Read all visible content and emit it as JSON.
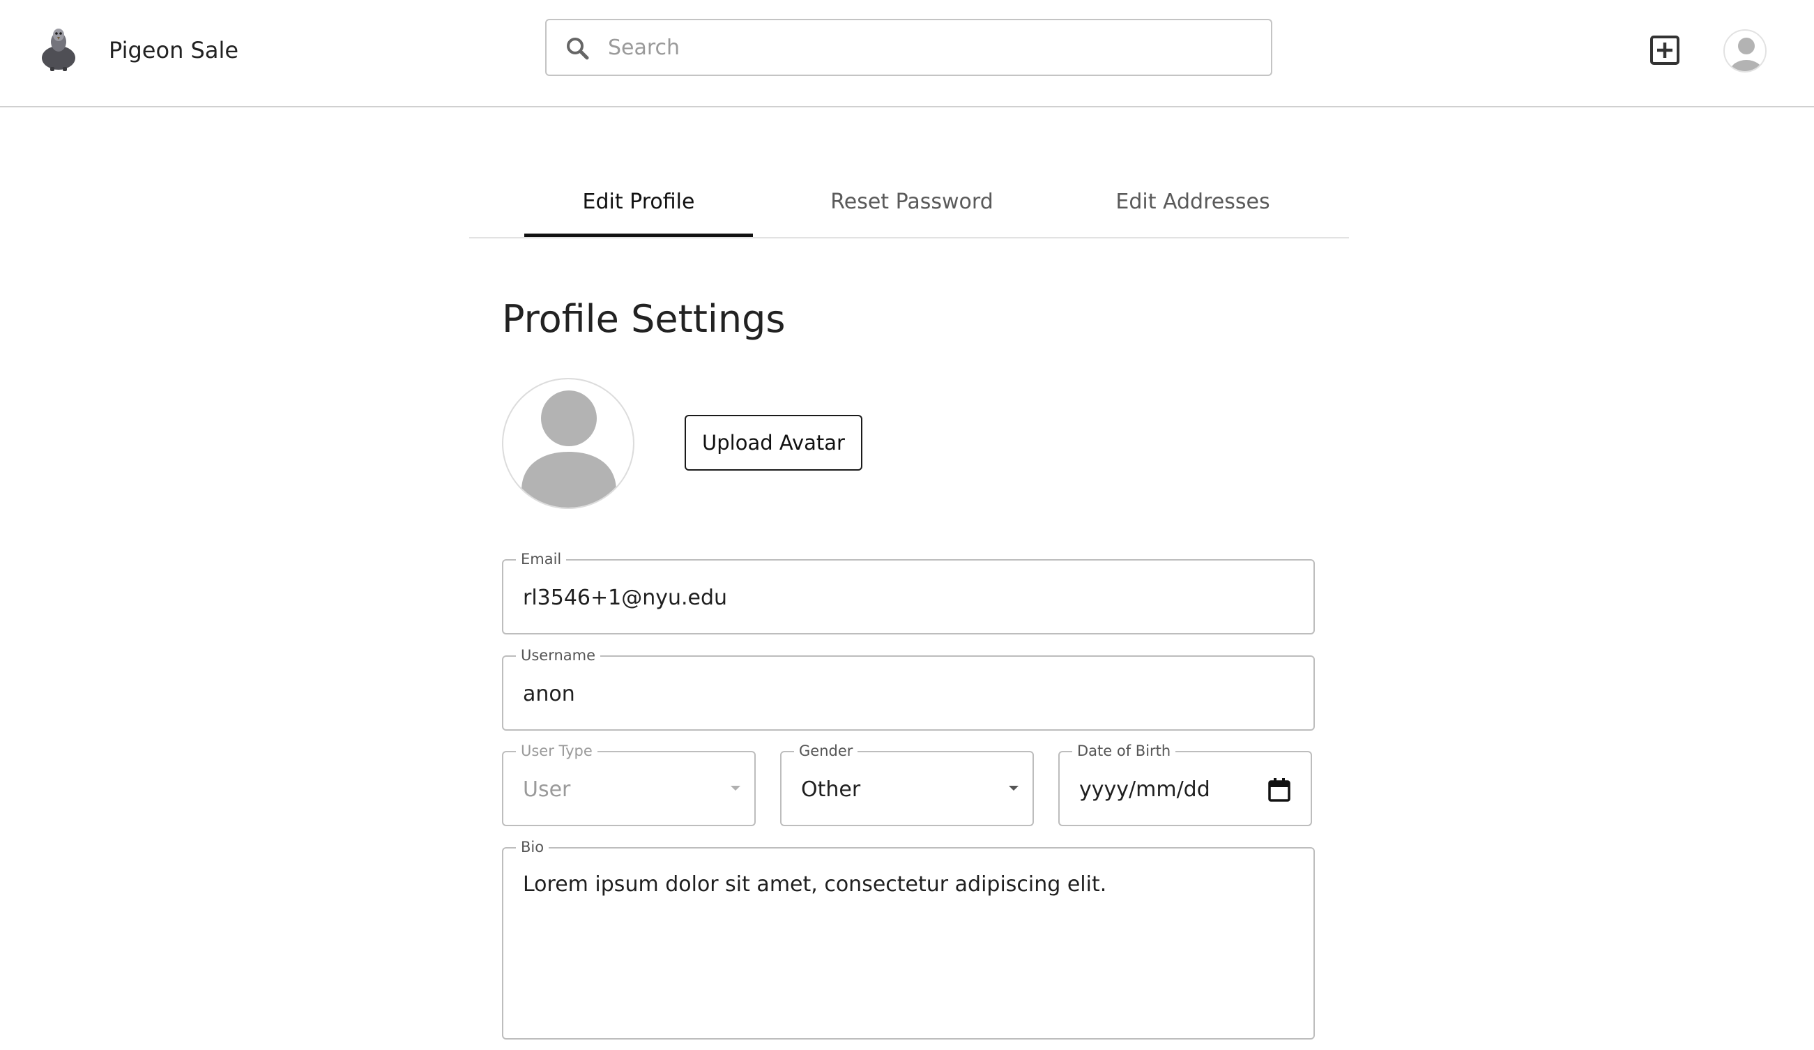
{
  "header": {
    "brand": "Pigeon Sale",
    "logo_icon": "pigeon-logo-icon",
    "search_placeholder": "Search",
    "search_value": "",
    "search_icon": "search-icon",
    "add_icon": "add-box-icon",
    "avatar_icon": "user-avatar-icon"
  },
  "tabs": [
    {
      "label": "Edit Profile",
      "active": true
    },
    {
      "label": "Reset Password",
      "active": false
    },
    {
      "label": "Edit Addresses",
      "active": false
    }
  ],
  "profile": {
    "title": "Profile Settings",
    "avatar_icon": "default-avatar-icon",
    "upload_label": "Upload Avatar"
  },
  "form": {
    "email": {
      "label": "Email",
      "value": "rl3546+1@nyu.edu"
    },
    "username": {
      "label": "Username",
      "value": "anon"
    },
    "user_type": {
      "label": "User Type",
      "value": "User",
      "disabled": true
    },
    "gender": {
      "label": "Gender",
      "value": "Other"
    },
    "dob": {
      "label": "Date of Birth",
      "value": "yyyy/mm/dd",
      "icon": "calendar-icon"
    },
    "bio": {
      "label": "Bio",
      "value": "Lorem ipsum dolor sit amet, consectetur adipiscing elit."
    }
  },
  "colors": {
    "accent": "#111111",
    "border": "#bdbdbd",
    "muted_text": "#9a9a9a",
    "avatar_gray": "#b3b3b3"
  }
}
